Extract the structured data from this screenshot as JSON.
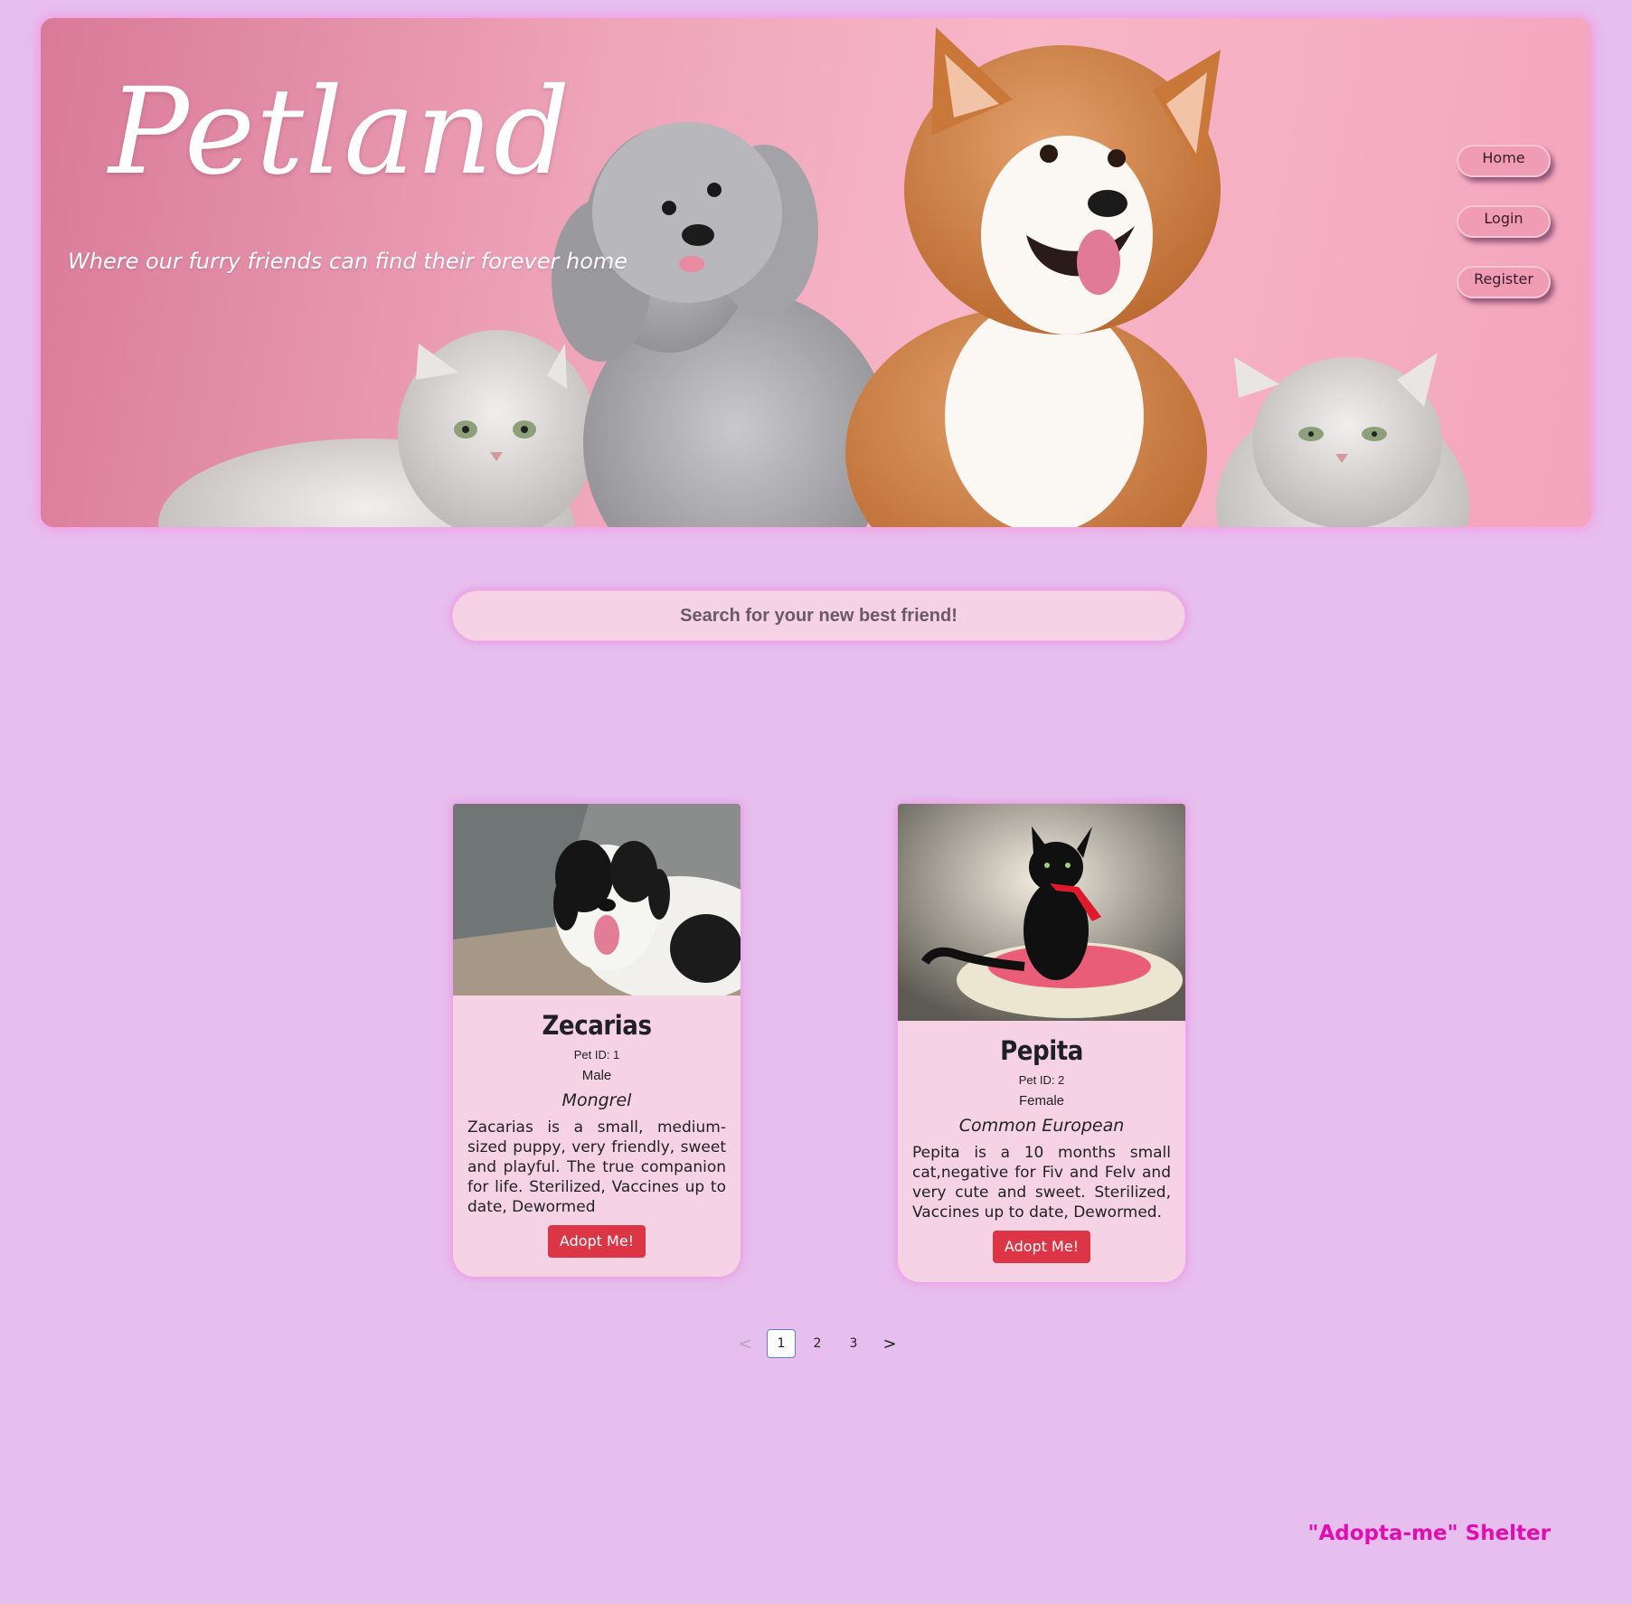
{
  "header": {
    "title": "Petland",
    "tagline": "Where our furry friends can find their forever home"
  },
  "nav": {
    "items": [
      {
        "label": "Home"
      },
      {
        "label": "Login"
      },
      {
        "label": "Register"
      }
    ]
  },
  "search": {
    "placeholder": "Search for your new best friend!",
    "value": ""
  },
  "pets": [
    {
      "name": "Zecarias",
      "id_label": "Pet ID: 1",
      "sex": "Male",
      "breed": "Mongrel",
      "description": "Zacarias is a small, medium-sized puppy, very friendly, sweet and playful. The true companion for life. Sterilized, Vaccines up to date, Dewormed",
      "button_label": "Adopt Me!"
    },
    {
      "name": "Pepita",
      "id_label": "Pet ID: 2",
      "sex": "Female",
      "breed": "Common European",
      "description": "Pepita is a 10 months small cat,negative for Fiv and Felv and very cute and sweet. Sterilized, Vaccines up to date, Dewormed.",
      "button_label": "Adopt Me!"
    }
  ],
  "pagination": {
    "prev": "<",
    "pages": [
      "1",
      "2",
      "3"
    ],
    "current": "1",
    "next": ">"
  },
  "footer": {
    "brand": "\"Adopta-me\" Shelter"
  },
  "colors": {
    "page_bg": "#e6bfee",
    "card_bg": "#f5d3e4",
    "accent_pink": "#e20db0",
    "adopt_button": "#dc3546",
    "nav_button": "#ef9cb4"
  }
}
